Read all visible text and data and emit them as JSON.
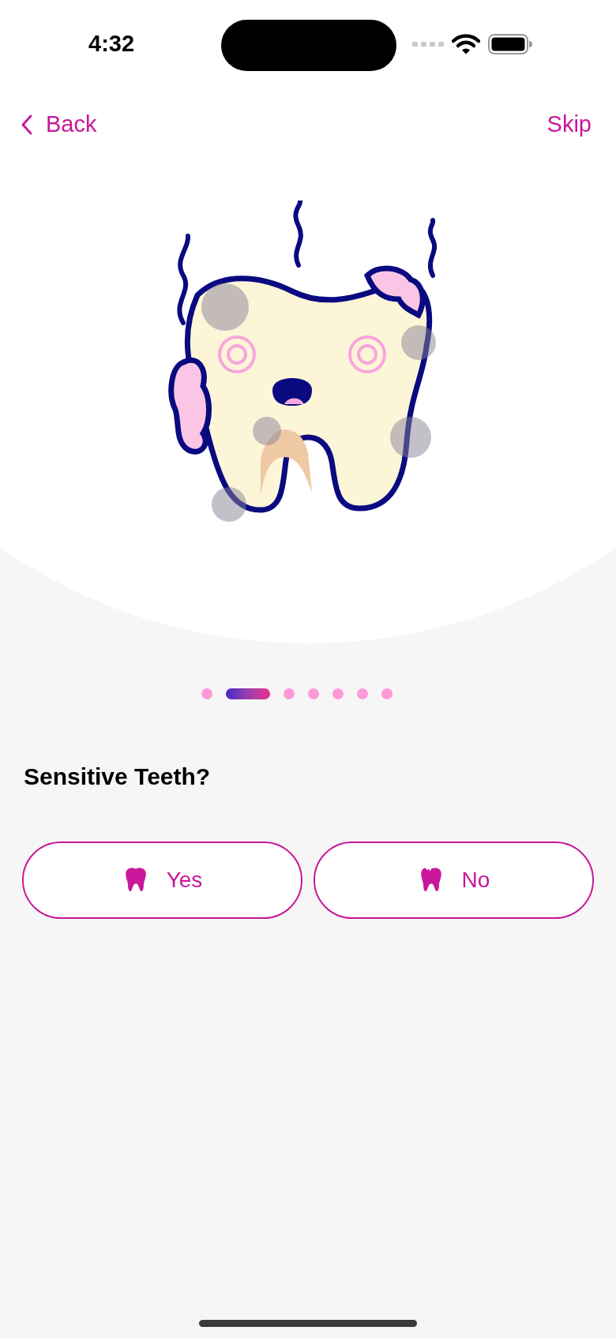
{
  "status_bar": {
    "time": "4:32"
  },
  "nav": {
    "back": "Back",
    "skip": "Skip"
  },
  "pager": [
    {
      "selected": false
    },
    {
      "selected": true
    },
    {
      "selected": false
    },
    {
      "selected": false
    },
    {
      "selected": false
    },
    {
      "selected": false
    },
    {
      "selected": false
    }
  ],
  "question": "Sensitive Teeth?",
  "answers": [
    {
      "label": "Yes",
      "kind": "healthy"
    },
    {
      "label": "No",
      "kind": "chipped"
    }
  ]
}
